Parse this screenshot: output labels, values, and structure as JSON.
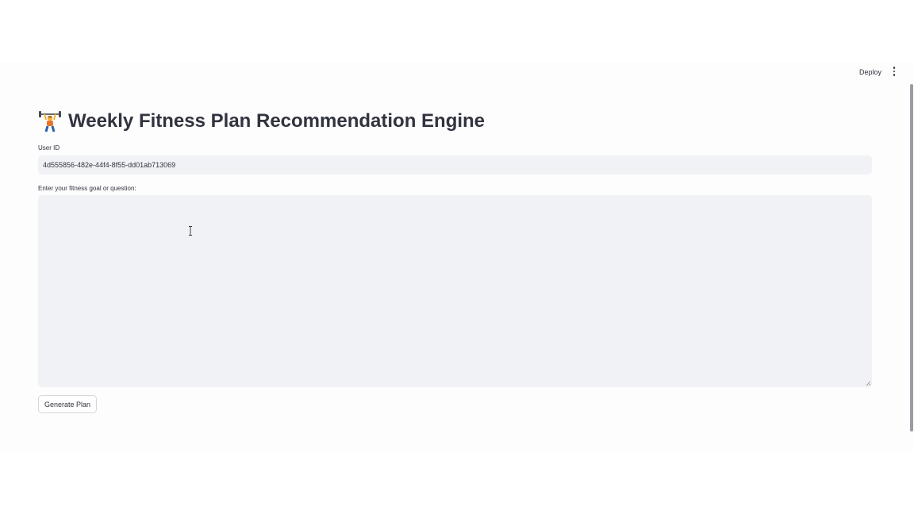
{
  "header": {
    "deploy_label": "Deploy",
    "menu_icon": "vertical-ellipsis-icon"
  },
  "main": {
    "title_emoji_icon": "weight-lifter-icon",
    "title": "Weekly Fitness Plan Recommendation Engine",
    "user_id": {
      "label": "User ID",
      "value": "4d555856-482e-44f4-8f55-dd01ab713069"
    },
    "goal": {
      "label": "Enter your fitness goal or question:",
      "value": "",
      "placeholder": ""
    },
    "generate_button_label": "Generate Plan"
  },
  "colors": {
    "input_background": "#f0f2f6",
    "text": "#31333f",
    "page_background": "#fdfdfd"
  }
}
